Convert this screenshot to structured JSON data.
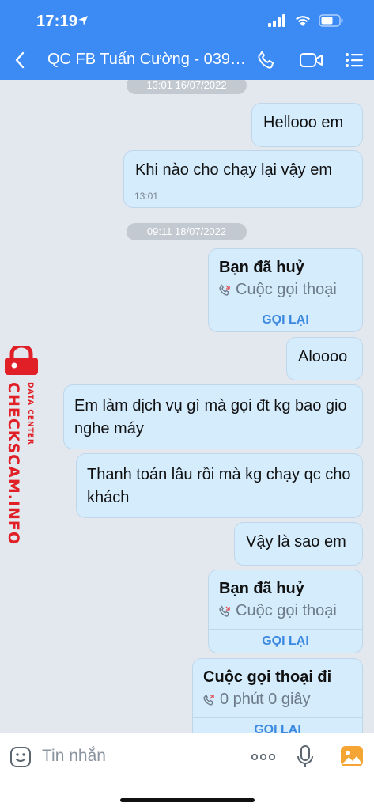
{
  "status_bar": {
    "time": "17:19"
  },
  "header": {
    "title": "QC FB Tuấn Cường - 0393...",
    "icons": [
      "back-icon",
      "phone-icon",
      "video-icon",
      "menu-icon"
    ],
    "color": "#3c8bf5"
  },
  "chat": {
    "timestamps": [
      "13:01 16/07/2022",
      "09:11 18/07/2022"
    ],
    "messages": [
      {
        "text": "Hellooo em"
      },
      {
        "text": "Khi nào cho chạy lại vậy em",
        "time": "13:01"
      },
      {
        "text": "Aloooo"
      },
      {
        "text": "Em làm dịch vụ gì mà gọi đt kg bao gio nghe máy"
      },
      {
        "text": "Thanh toán lâu rồi mà kg chạy qc cho khách"
      },
      {
        "text": "Vậy là sao em"
      }
    ],
    "calls": [
      {
        "title": "Bạn đã huỷ",
        "subtitle": "Cuộc gọi thoại",
        "action": "GỌI LẠI"
      },
      {
        "title": "Bạn đã huỷ",
        "subtitle": "Cuộc gọi thoại",
        "action": "GỌI LẠI"
      },
      {
        "title": "Cuộc gọi thoại đi",
        "subtitle": "0 phút 0 giây",
        "action": "GỌI LẠI"
      }
    ],
    "bubble_color": "#d5ecfd",
    "accent": "#3b89e0"
  },
  "watermark": {
    "main": "CHECKSCAM.INFO",
    "sub": "DATA CENTER",
    "color": "#e01f26"
  },
  "input_bar": {
    "placeholder": "Tin nhắn",
    "icons": [
      "emoji-icon",
      "more-icon",
      "mic-icon",
      "image-icon"
    ]
  }
}
